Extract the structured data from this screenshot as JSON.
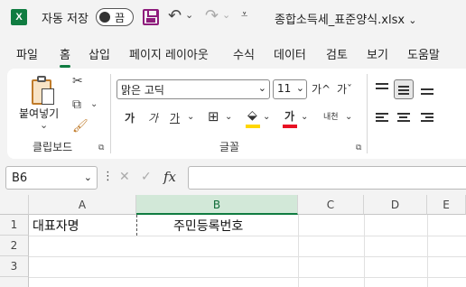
{
  "app": {
    "logo": "X",
    "autosave_label": "자동 저장",
    "autosave_state": "끔",
    "filename": "종합소득세_표준양식.xlsx",
    "accent": "#107c41"
  },
  "quick_access": {
    "icons": [
      "save-icon",
      "undo-icon",
      "redo-icon",
      "customize-icon"
    ],
    "undo_glyph": "↶",
    "redo_glyph": "↷",
    "dropdown_glyph": "⌄",
    "customize_glyph": "⩡"
  },
  "tabs": [
    "파일",
    "홈",
    "삽입",
    "페이지 레이아웃",
    "수식",
    "데이터",
    "검토",
    "보기",
    "도움말"
  ],
  "active_tab": "홈",
  "ribbon": {
    "clipboard": {
      "label": "클립보드",
      "paste_label": "붙여넣기",
      "paste_caret": "⌄",
      "cut_glyph": "✂",
      "copy_glyph": "⧉",
      "format_painter_glyph": "🖌"
    },
    "font": {
      "label": "글꼴",
      "font_name": "맑은 고딕",
      "font_size": "11",
      "grow": "가^",
      "shrink": "가ˇ",
      "bold": "가",
      "italic": "가",
      "underline": "가",
      "border_glyph": "⊞",
      "fill_glyph": "⬙",
      "fill_color": "#ffd700",
      "font_color_glyph": "가",
      "font_color": "#e81123",
      "phonetic": "내천",
      "caret": "⌄"
    },
    "dialog_launcher_glyph": "⧉"
  },
  "formula_bar": {
    "name_box": "B6",
    "cancel_glyph": "✕",
    "enter_glyph": "✓",
    "fx_label": "fx",
    "more_glyph": "⋮",
    "value": ""
  },
  "sheet": {
    "columns": [
      "A",
      "B",
      "C",
      "D",
      "E"
    ],
    "selected_column": "B",
    "rows": [
      "1",
      "2",
      "3"
    ],
    "cells": {
      "A1": "대표자명",
      "B1": "주민등록번호"
    }
  }
}
